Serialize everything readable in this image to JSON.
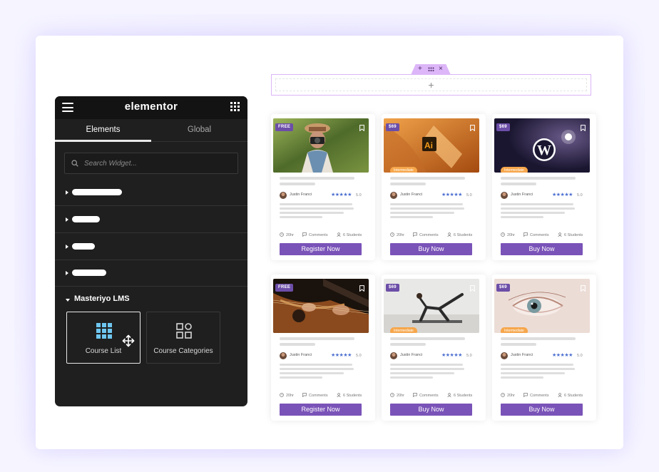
{
  "panel": {
    "logo": "elementor",
    "tabs": [
      "Elements",
      "Global"
    ],
    "search_placeholder": "Search Widget...",
    "section_title": "Masteriyo LMS",
    "widgets": [
      "Course List",
      "Course Categories"
    ]
  },
  "section": {
    "add_label": "+",
    "handle_add": "+",
    "handle_close": "×"
  },
  "courses": [
    {
      "badge": "FREE",
      "tag": "",
      "author": "Justin Franci",
      "stars": "★★★★★",
      "rating": "5.0",
      "duration": "20hr",
      "comments": "Comments",
      "students": "6 Students",
      "cta": "Register Now"
    },
    {
      "badge": "$69",
      "tag": "Intermediate",
      "author": "Justin Franci",
      "stars": "★★★★★",
      "rating": "5.0",
      "duration": "20hr",
      "comments": "Comments",
      "students": "6 Students",
      "cta": "Buy Now"
    },
    {
      "badge": "$69",
      "tag": "Intermediate",
      "author": "Justin Franci",
      "stars": "★★★★★",
      "rating": "5.0",
      "duration": "20hr",
      "comments": "Comments",
      "students": "6 Students",
      "cta": "Buy Now"
    },
    {
      "badge": "FREE",
      "tag": "",
      "author": "Justin Franci",
      "stars": "★★★★★",
      "rating": "5.0",
      "duration": "20hr",
      "comments": "Comments",
      "students": "6 Students",
      "cta": "Register Now"
    },
    {
      "badge": "$69",
      "tag": "Intermediate",
      "author": "Justin Franci",
      "stars": "★★★★★",
      "rating": "5.0",
      "duration": "20hr",
      "comments": "Comments",
      "students": "6 Students",
      "cta": "Buy Now"
    },
    {
      "badge": "$69",
      "tag": "Intermediate",
      "author": "Justin Franci",
      "stars": "★★★★★",
      "rating": "5.0",
      "duration": "20hr",
      "comments": "Comments",
      "students": "6 Students",
      "cta": "Buy Now"
    }
  ],
  "colors": {
    "accent": "#7a53b8",
    "badge": "#6c4ea8",
    "tag": "#f6a64b",
    "stars": "#4d6fd0",
    "panel": "#1f1f1f"
  }
}
